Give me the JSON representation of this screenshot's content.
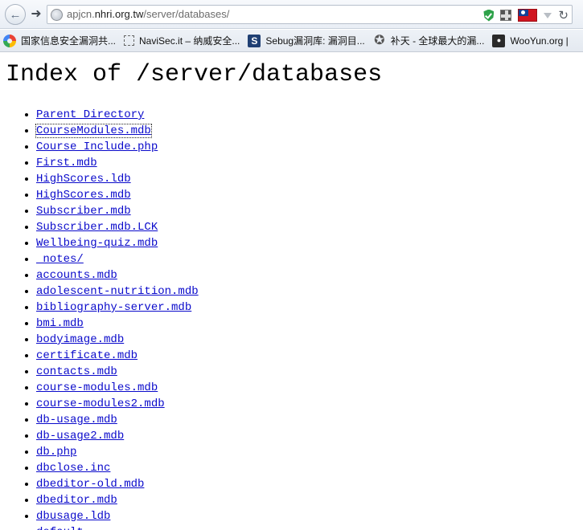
{
  "browser": {
    "url_prefix": "apjcn.",
    "url_domain": "nhri.org.tw",
    "url_path": "/server/databases/",
    "back_icon": "arrow-left-icon",
    "forward_icon": "arrow-right-icon",
    "reload_icon": "reload-icon"
  },
  "bookmarks": [
    {
      "label": "国家信息安全漏洞共...",
      "icon": "chrome-c-icon"
    },
    {
      "label": "NaviSec.it – 纳威安全...",
      "icon": "dashed-square-icon"
    },
    {
      "label": "Sebug漏洞库: 漏洞目...",
      "icon": "sebug-s-icon"
    },
    {
      "label": "补天 - 全球最大的漏...",
      "icon": "star-icon"
    },
    {
      "label": "WooYun.org |",
      "icon": "wooyun-icon"
    }
  ],
  "page": {
    "title": "Index of /server/databases",
    "items": [
      "Parent Directory",
      "CourseModules.mdb",
      "Course_Include.php",
      "First.mdb",
      "HighScores.ldb",
      "HighScores.mdb",
      "Subscriber.mdb",
      "Subscriber.mdb.LCK",
      "Wellbeing-quiz.mdb",
      "_notes/",
      "accounts.mdb",
      "adolescent-nutrition.mdb",
      "bibliography-server.mdb",
      "bmi.mdb",
      "bodyimage.mdb",
      "certificate.mdb",
      "contacts.mdb",
      "course-modules.mdb",
      "course-modules2.mdb",
      "db-usage.mdb",
      "db-usage2.mdb",
      "db.php",
      "dbclose.inc",
      "dbeditor-old.mdb",
      "dbeditor.mdb",
      "dbusage.ldb",
      "default..."
    ]
  },
  "colors": {
    "link": "#0a0acb",
    "shield": "#2ea24a"
  }
}
